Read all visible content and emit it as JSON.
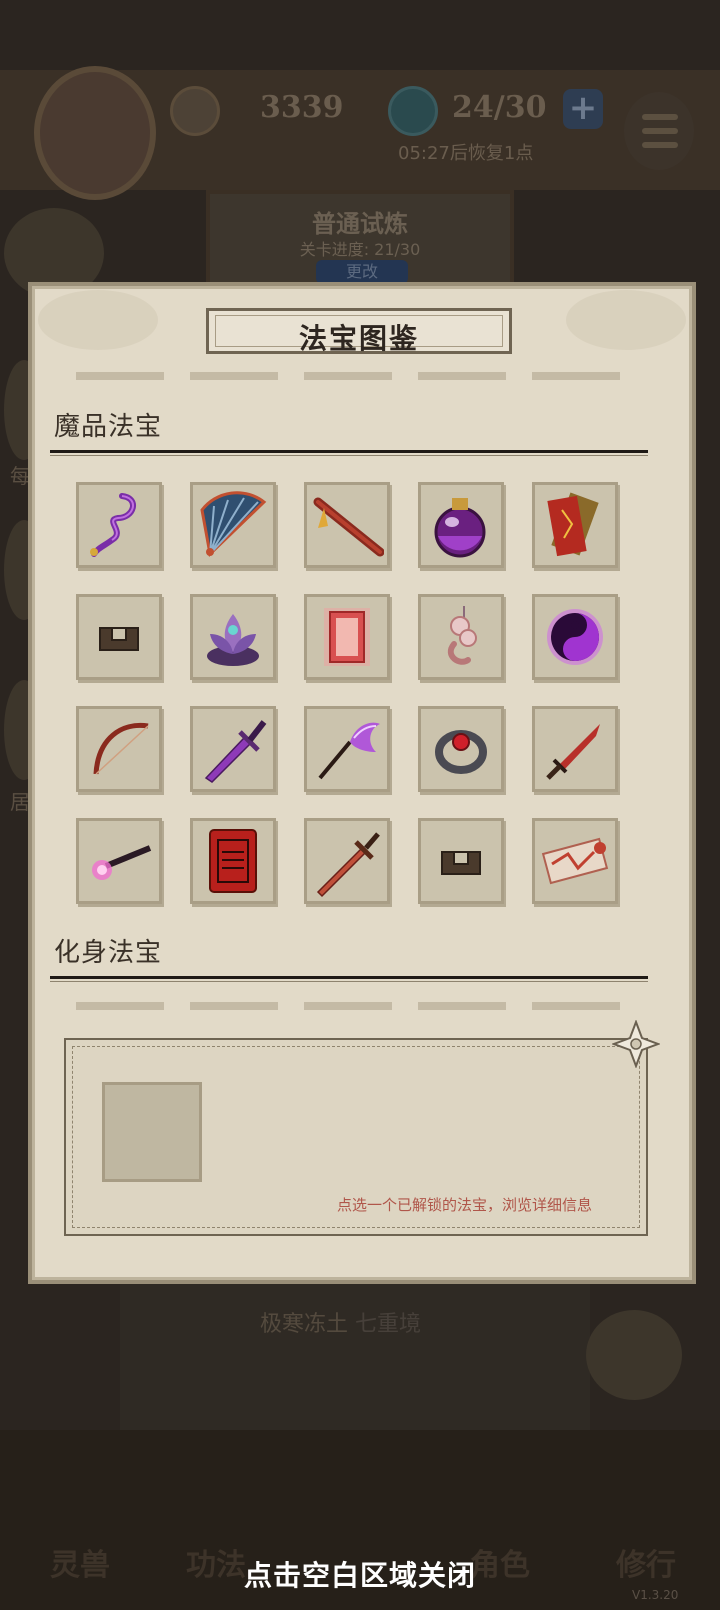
{
  "header": {
    "coin_value": "3339",
    "stamina_value": "24/30",
    "plus_label": "+",
    "regen_text": "05:27后恢复1点"
  },
  "trial": {
    "title": "普通试炼",
    "progress": "关卡进度: 21/30",
    "button": "更改"
  },
  "stage": {
    "name": "极寒冻土",
    "realm": "七重境"
  },
  "bottom_nav": [
    "灵兽",
    "功法",
    "法宝",
    "角色",
    "修行"
  ],
  "version": "V1.3.20",
  "close_hint": "点击空白区域关闭",
  "side_labels": [
    "每",
    "居",
    "居"
  ],
  "modal": {
    "title": "法宝图鉴",
    "sections": [
      {
        "title": "魔品法宝",
        "items": [
          "rope-whip-icon",
          "folding-fan-icon",
          "flute-icon",
          "potion-flask-icon",
          "talisman-icon",
          "jade-slip-icon",
          "lotus-flower-icon",
          "glowing-scroll-icon",
          "jade-pendant-icon",
          "yin-yang-icon",
          "bow-icon",
          "purple-sword-icon",
          "purple-whisk-icon",
          "ruby-ring-icon",
          "dagger-icon",
          "flame-brush-icon",
          "red-banner-icon",
          "bronze-sword-icon",
          "jade-slip-icon",
          "scroll-bundle-icon"
        ]
      },
      {
        "title": "化身法宝",
        "items": []
      }
    ],
    "detail": {
      "hint": "点选一个已解锁的法宝，浏览详细信息"
    }
  },
  "colors": {
    "panel": "#e2dac8",
    "slot": "#cbc3ad",
    "accent_purple": "#8e3ab8",
    "accent_red": "#b8302a",
    "hint_text": "#b0564a"
  }
}
